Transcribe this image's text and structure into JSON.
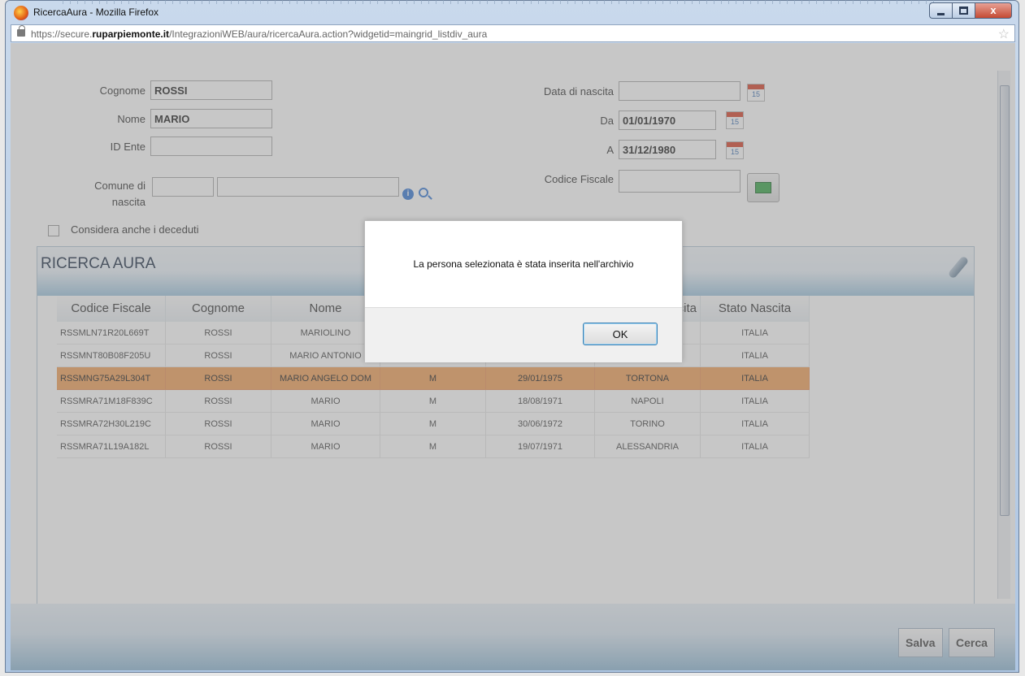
{
  "window": {
    "title": "RicercaAura - Mozilla Firefox",
    "url_prefix": "https://secure.",
    "url_domain": "ruparpiemonte.it",
    "url_path": "/IntegrazioniWEB/aura/ricercaAura.action?widgetid=maingrid_listdiv_aura",
    "close_label": "x"
  },
  "form": {
    "cognome_label": "Cognome",
    "cognome_value": "ROSSI",
    "nome_label": "Nome",
    "nome_value": "MARIO",
    "id_ente_label": "ID Ente",
    "id_ente_value": "",
    "comune_label_1": "Comune di",
    "comune_label_2": "nascita",
    "data_nascita_label": "Data di nascita",
    "data_nascita_value": "",
    "da_label": "Da",
    "da_value": "01/01/1970",
    "a_label": "A",
    "a_value": "31/12/1980",
    "codice_fiscale_label": "Codice Fiscale",
    "codice_fiscale_value": "",
    "considera_label": "Considera anche i deceduti",
    "calendar_day": "15"
  },
  "grid": {
    "title": "RICERCA AURA",
    "columns": [
      "Codice Fiscale",
      "Cognome",
      "Nome",
      "",
      "",
      "cita",
      "Stato Nascita"
    ],
    "rows": [
      [
        "RSSMLN71R20L669T",
        "ROSSI",
        "MARIOLINO",
        "",
        "",
        "",
        "ITALIA"
      ],
      [
        "RSSMNT80B08F205U",
        "ROSSI",
        "MARIO ANTONIO",
        "",
        "",
        "",
        "ITALIA"
      ],
      [
        "RSSMNG75A29L304T",
        "ROSSI",
        "MARIO ANGELO DOM",
        "M",
        "29/01/1975",
        "TORTONA",
        "ITALIA"
      ],
      [
        "RSSMRA71M18F839C",
        "ROSSI",
        "MARIO",
        "M",
        "18/08/1971",
        "NAPOLI",
        "ITALIA"
      ],
      [
        "RSSMRA72H30L219C",
        "ROSSI",
        "MARIO",
        "M",
        "30/06/1972",
        "TORINO",
        "ITALIA"
      ],
      [
        "RSSMRA71L19A182L",
        "ROSSI",
        "MARIO",
        "M",
        "19/07/1971",
        "ALESSANDRIA",
        "ITALIA"
      ]
    ],
    "selected_row": 2
  },
  "footer": {
    "salva_label": "Salva",
    "cerca_label": "Cerca"
  },
  "modal": {
    "message": "La persona selezionata è stata inserita nell'archivio",
    "ok_label": "OK"
  }
}
